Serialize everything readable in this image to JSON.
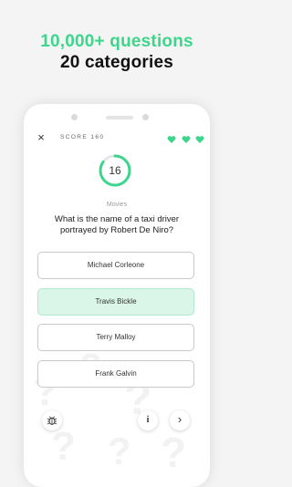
{
  "hero": {
    "line1": "10,000+ questions",
    "line2": "20 categories"
  },
  "colors": {
    "accent": "#3dd68c",
    "correct_bg": "#d9f6e8",
    "background": "#f3f4f3"
  },
  "game": {
    "close_icon": "×",
    "score_label": "SCORE 160",
    "lives": 3,
    "timer": "16",
    "timer_fraction": 0.85,
    "category": "Movies",
    "question": "What is the name of a taxi driver portrayed by Robert De Niro?",
    "answers": [
      {
        "label": "Michael Corleone",
        "state": "default"
      },
      {
        "label": "Travis Bickle",
        "state": "correct"
      },
      {
        "label": "Terry Malloy",
        "state": "default"
      },
      {
        "label": "Frank Galvin",
        "state": "default"
      }
    ]
  },
  "toolbar": {
    "bug_icon": "bug-icon",
    "info_label": "i",
    "next_label": "›"
  }
}
